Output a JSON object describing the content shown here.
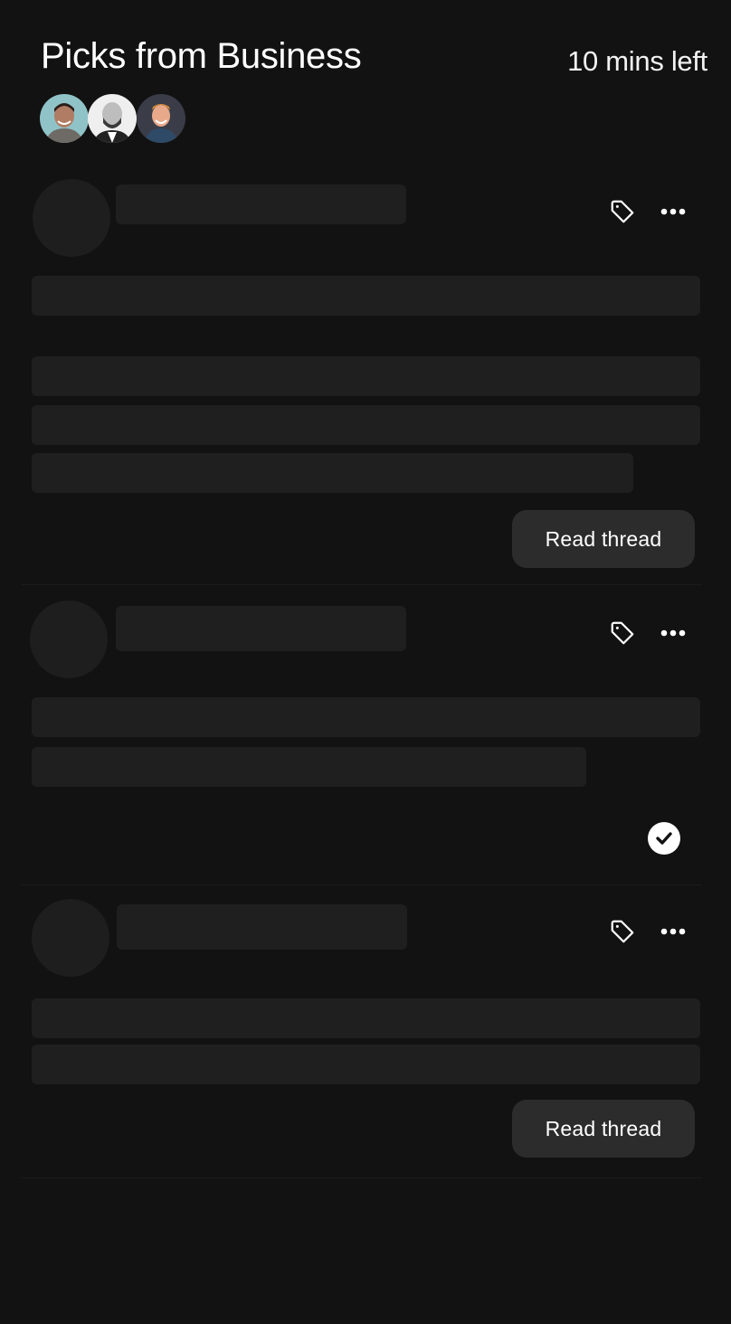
{
  "header": {
    "title": "Picks from Business",
    "time_left": "10 mins left",
    "avatars": [
      {
        "name": "avatar-1",
        "bg": "#8fc3c8"
      },
      {
        "name": "avatar-2",
        "bg": "#e8e8e8"
      },
      {
        "name": "avatar-3",
        "bg": "#3a3d48"
      }
    ]
  },
  "cards": [
    {
      "action": "Read thread",
      "state": "loading"
    },
    {
      "action": "completed",
      "state": "loading"
    },
    {
      "action": "Read thread",
      "state": "loading"
    }
  ],
  "icons": {
    "tag": "tag-icon",
    "more": "more-icon",
    "check": "check-icon"
  }
}
